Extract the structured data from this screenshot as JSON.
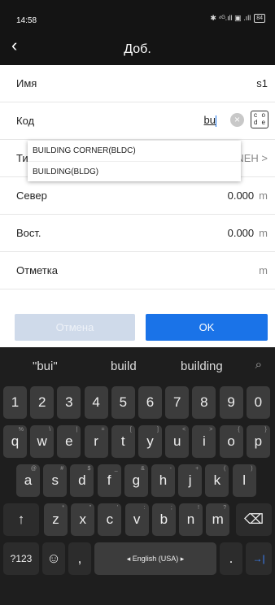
{
  "status": {
    "time": "14:58",
    "icons": "✱ ⁴ᴳ.ıll ▣ .ıll",
    "battery": "84"
  },
  "titlebar": {
    "back_icon": "‹",
    "title": "Доб."
  },
  "form": {
    "name": {
      "label": "Имя",
      "value": "s1"
    },
    "code": {
      "label": "Код",
      "value": "bu",
      "clear": "×",
      "codes_icon": "⸨ ⸩"
    },
    "type": {
      "label": "Тип",
      "value": "NEH",
      "chevron": ">"
    },
    "north": {
      "label": "Север",
      "value": "0.000",
      "unit": "m"
    },
    "east": {
      "label": "Вост.",
      "value": "0.000",
      "unit": "m"
    },
    "elev": {
      "label": "Отметка",
      "value": "",
      "unit": "m"
    }
  },
  "dropdown": {
    "options": [
      "BUILDING CORNER(BLDC)",
      "BUILDING(BLDG)"
    ]
  },
  "buttons": {
    "cancel": "Отмена",
    "ok": "OK"
  },
  "keyboard": {
    "suggestions": [
      "\"bui\"",
      "build",
      "building"
    ],
    "search_icon": "⌕",
    "numbers": [
      "1",
      "2",
      "3",
      "4",
      "5",
      "6",
      "7",
      "8",
      "9",
      "0"
    ],
    "row1": [
      "q",
      "w",
      "e",
      "r",
      "t",
      "y",
      "u",
      "i",
      "o",
      "p"
    ],
    "row1_hints": [
      "%",
      "\\",
      "|",
      "=",
      "[",
      "]",
      "<",
      ">",
      "{",
      "}"
    ],
    "row2": [
      "a",
      "s",
      "d",
      "f",
      "g",
      "h",
      "j",
      "k",
      "l"
    ],
    "row2_hints": [
      "@",
      "#",
      "$",
      "_",
      "&",
      "-",
      "+",
      "(",
      ")"
    ],
    "row3": [
      "z",
      "x",
      "c",
      "v",
      "b",
      "n",
      "m"
    ],
    "row3_hints": [
      "*",
      "\"",
      "'",
      ":",
      ";",
      "!",
      "?"
    ],
    "shift": "↑",
    "backspace": "⌫",
    "symbols": "?123",
    "emoji": "☺",
    "comma": ",",
    "space": "◂ English (USA) ▸",
    "period": ".",
    "enter": "→|"
  }
}
